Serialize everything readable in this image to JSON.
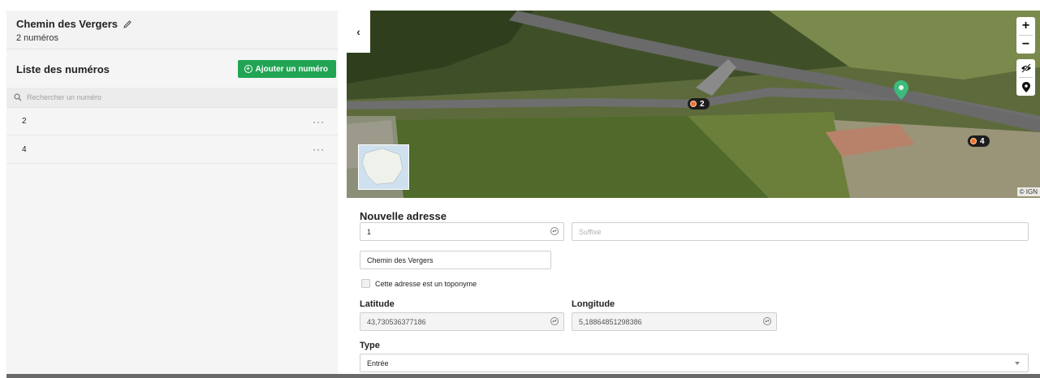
{
  "street": {
    "name": "Chemin des Vergers",
    "count": "2 numéros"
  },
  "list": {
    "title": "Liste des numéros",
    "add_button": "Ajouter un numéro",
    "search_placeholder": "Rechercher un numéro",
    "items": [
      {
        "number": "2",
        "menu": "···"
      },
      {
        "number": "4",
        "menu": "···"
      }
    ]
  },
  "map": {
    "collapse": "‹",
    "zoom_in": "+",
    "zoom_out": "−",
    "copyright": "© IGN",
    "labels": [
      {
        "text": "2"
      },
      {
        "text": "4"
      }
    ]
  },
  "form": {
    "title": "Nouvelle adresse",
    "number_value": "1",
    "suffix_placeholder": "Suffixe",
    "street_value": "Chemin des Vergers",
    "toponym_label": "Cette adresse est un toponyme",
    "latitude_label": "Latitude",
    "latitude_value": "43,730536377186",
    "longitude_label": "Longitude",
    "longitude_value": "5,18864851298386",
    "type_label": "Type",
    "type_value": "Entrée"
  },
  "colors": {
    "accent_green": "#21a454",
    "marker_orange": "#f27127",
    "pin_green": "#3dbb7c"
  }
}
